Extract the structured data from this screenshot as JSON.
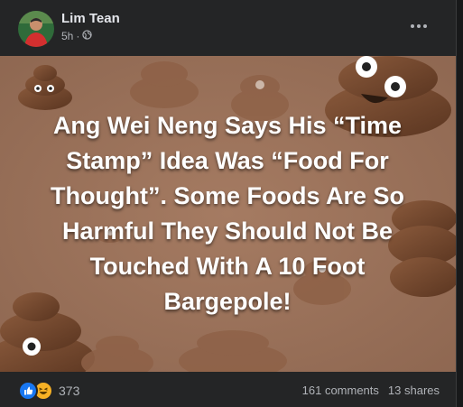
{
  "post": {
    "author": "Lim Tean",
    "time": "5h",
    "separator": "·",
    "privacy_icon": "globe-icon",
    "more_icon": "more-options-icon"
  },
  "image": {
    "headline": "Ang Wei Neng Says His “Time Stamp” Idea Was “Food For Thought”. Some Foods Are So Harmful They Should Not Be Touched With A 10 Foot Bargepole!",
    "background": "poop-emoji-pattern"
  },
  "footer": {
    "reactions_count": "373",
    "reaction_icons": [
      "like-icon",
      "haha-icon"
    ],
    "comments": "161 comments",
    "shares": "13 shares"
  },
  "colors": {
    "card_bg": "#242526",
    "text_primary": "#e4e6eb",
    "text_secondary": "#b0b3b8",
    "image_bg": "#a47a62",
    "like_blue": "#1877f2",
    "haha_yellow": "#f7b125"
  }
}
